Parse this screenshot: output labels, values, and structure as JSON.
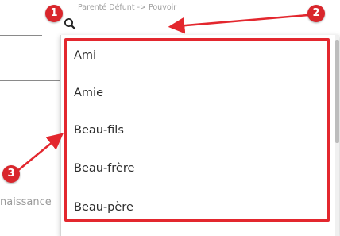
{
  "field": {
    "label": "Parenté Défunt -> Pouvoir",
    "search_value": "",
    "search_icon": "search-icon"
  },
  "background": {
    "partial_label": "naissance"
  },
  "dropdown": {
    "options": [
      {
        "label": "Ami"
      },
      {
        "label": "Amie"
      },
      {
        "label": "Beau-fils"
      },
      {
        "label": "Beau-frère"
      },
      {
        "label": "Beau-père"
      }
    ]
  },
  "annotations": {
    "badges": [
      "1",
      "2",
      "3"
    ],
    "color": "#d9262c"
  }
}
